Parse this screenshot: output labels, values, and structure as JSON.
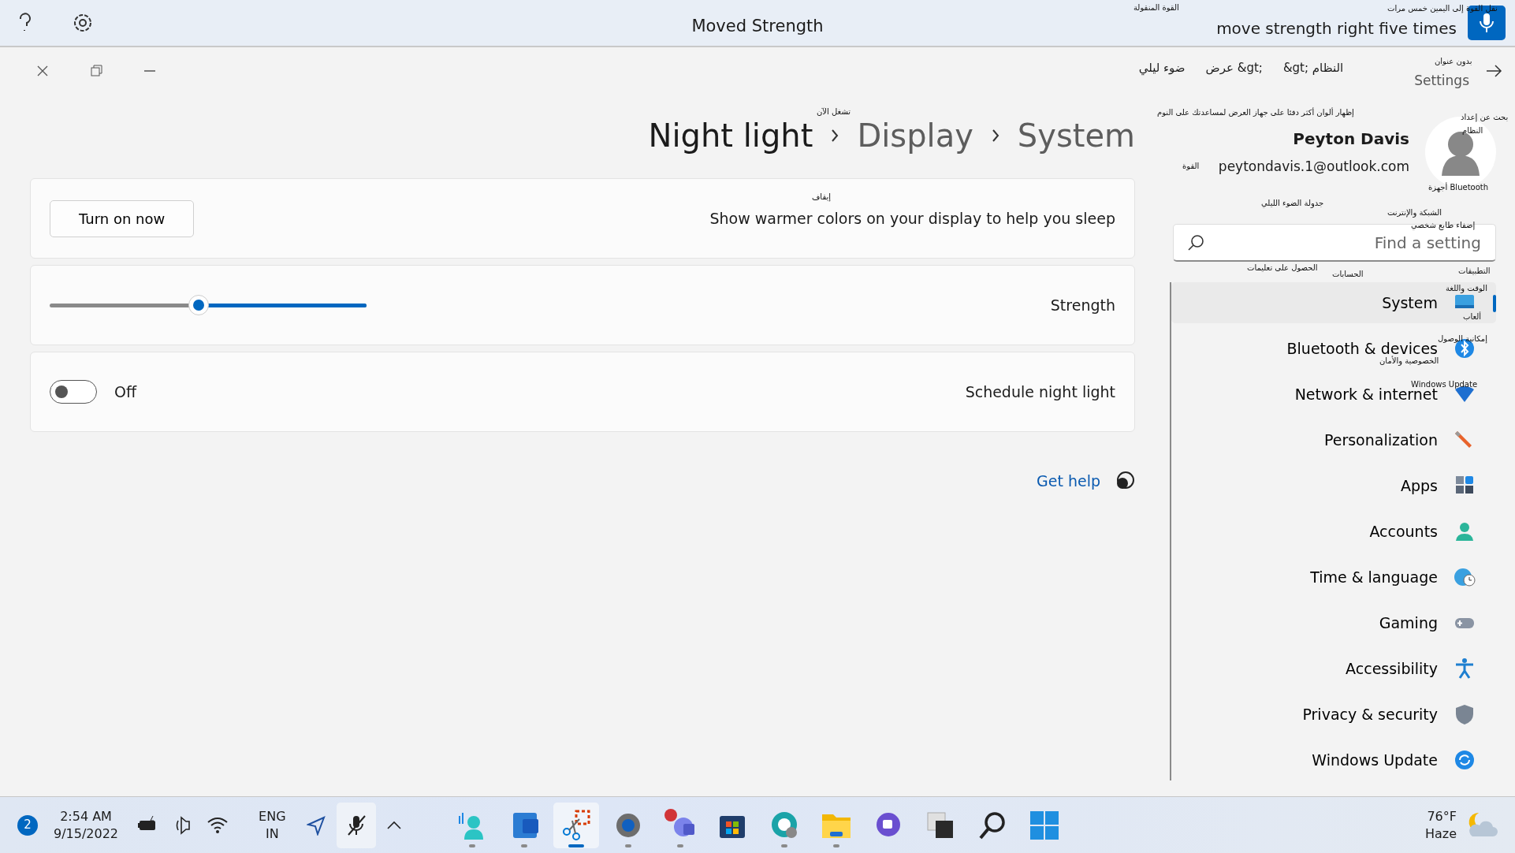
{
  "voice_bar": {
    "command": "move strength right five times",
    "title": "Moved Strength"
  },
  "window": {
    "app_title": "Settings",
    "caption_path": [
      "&gt; النظام",
      "عرض &gt;",
      "ضوء ليلي"
    ]
  },
  "user": {
    "name": "Peyton Davis",
    "email": "peytondavis.1@outlook.com"
  },
  "search": {
    "placeholder": "Find a setting"
  },
  "nav": [
    {
      "label": "System",
      "selected": true
    },
    {
      "label": "Bluetooth & devices",
      "selected": false
    },
    {
      "label": "Network & internet",
      "selected": false
    },
    {
      "label": "Personalization",
      "selected": false
    },
    {
      "label": "Apps",
      "selected": false
    },
    {
      "label": "Accounts",
      "selected": false
    },
    {
      "label": "Time & language",
      "selected": false
    },
    {
      "label": "Gaming",
      "selected": false
    },
    {
      "label": "Accessibility",
      "selected": false
    },
    {
      "label": "Privacy & security",
      "selected": false
    },
    {
      "label": "Windows Update",
      "selected": false
    }
  ],
  "page": {
    "breadcrumb": [
      "System",
      "Display",
      "Night light"
    ]
  },
  "settings": [
    {
      "kind": "button",
      "label": "Show warmer colors on your display to help you sleep",
      "button": "Turn on now"
    },
    {
      "kind": "slider",
      "label": "Strength",
      "level": 0.53
    },
    {
      "kind": "toggle",
      "label": "Schedule night light",
      "on": false,
      "state_label": "Off"
    }
  ],
  "help_link": "Get help",
  "captions": [
    {
      "text": "القوة المنقولة"
    },
    {
      "text": "نقل القوة إلى اليمين خمس مرات"
    },
    {
      "text": "بدون عنوان"
    },
    {
      "text": "تشغل الآن"
    },
    {
      "text": "إظهار ألوان أكثر دفئا على جهاز العرض لمساعدتك على النوم"
    },
    {
      "text": "بحث عن إعداد"
    },
    {
      "text": "النظام"
    },
    {
      "text": "القوة"
    },
    {
      "text": "أجهزة Bluetooth"
    },
    {
      "text": "إيقاف"
    },
    {
      "text": "جدولة الضوء الليلي"
    },
    {
      "text": "الشبكة والإنترنت"
    },
    {
      "text": "إضفاء طابع شخصي"
    },
    {
      "text": "الحصول على تعليمات"
    },
    {
      "text": "التطبيقات"
    },
    {
      "text": "الحسابات"
    },
    {
      "text": "الوقت واللغة"
    },
    {
      "text": "ألعاب"
    },
    {
      "text": "إمكانية الوصول"
    },
    {
      "text": "الخصوصية والأمان"
    },
    {
      "text": "Windows Update"
    }
  ],
  "taskbar": {
    "weather": {
      "temperature": "76°F",
      "condition": "Haze"
    },
    "apps": [
      {
        "running": false,
        "active": false
      },
      {
        "running": false,
        "active": false
      },
      {
        "running": false,
        "active": false
      },
      {
        "running": false,
        "active": false
      },
      {
        "running": true,
        "active": false
      },
      {
        "running": true,
        "active": false
      },
      {
        "running": false,
        "active": false
      },
      {
        "running": true,
        "active": false
      },
      {
        "running": true,
        "active": false
      },
      {
        "running": true,
        "active": true
      },
      {
        "running": true,
        "active": false
      },
      {
        "running": true,
        "active": false
      }
    ],
    "tray": {
      "mic_muted": true,
      "language": "ENG",
      "region": "IN",
      "time": "2:54 AM",
      "date": "9/15/2022",
      "notifications": "2"
    }
  }
}
